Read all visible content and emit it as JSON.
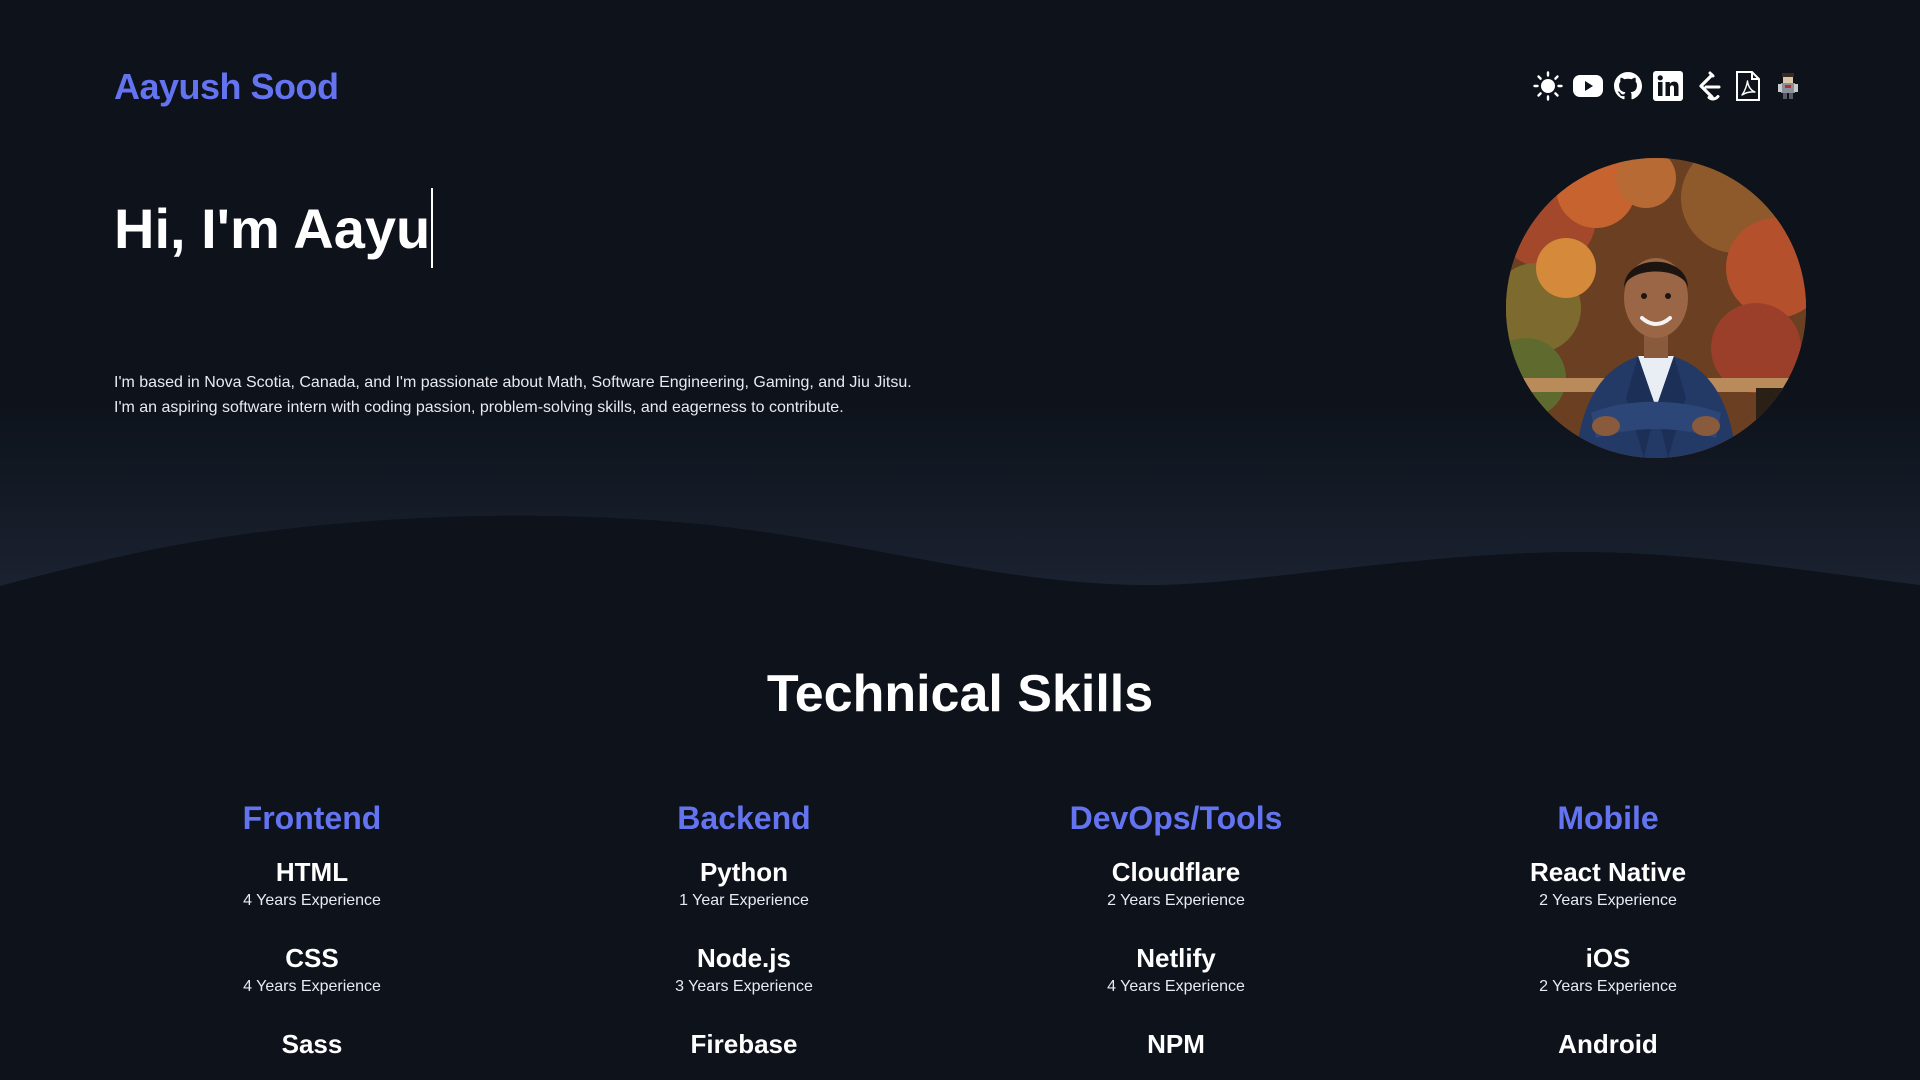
{
  "header": {
    "brand": "Aayush Sood",
    "icons": [
      {
        "name": "sun-icon",
        "label": "Toggle theme"
      },
      {
        "name": "youtube-icon",
        "label": "YouTube"
      },
      {
        "name": "github-icon",
        "label": "GitHub"
      },
      {
        "name": "linkedin-icon",
        "label": "LinkedIn"
      },
      {
        "name": "leetcode-icon",
        "label": "LeetCode"
      },
      {
        "name": "pdf-icon",
        "label": "Resume"
      },
      {
        "name": "character-icon",
        "label": "Game"
      }
    ]
  },
  "hero": {
    "greeting": "Hi, I'm Aayu",
    "line1": "I'm based in Nova Scotia, Canada, and I'm passionate about Math, Software Engineering, Gaming, and Jiu Jitsu.",
    "line2": "I'm an aspiring software intern with coding passion, problem-solving skills, and eagerness to contribute."
  },
  "skills": {
    "title": "Technical Skills",
    "categories": [
      {
        "title": "Frontend",
        "items": [
          {
            "name": "HTML",
            "experience": "4 Years Experience"
          },
          {
            "name": "CSS",
            "experience": "4 Years Experience"
          },
          {
            "name": "Sass",
            "experience": ""
          }
        ]
      },
      {
        "title": "Backend",
        "items": [
          {
            "name": "Python",
            "experience": "1 Year Experience"
          },
          {
            "name": "Node.js",
            "experience": "3 Years Experience"
          },
          {
            "name": "Firebase",
            "experience": ""
          }
        ]
      },
      {
        "title": "DevOps/Tools",
        "items": [
          {
            "name": "Cloudflare",
            "experience": "2 Years Experience"
          },
          {
            "name": "Netlify",
            "experience": "4 Years Experience"
          },
          {
            "name": "NPM",
            "experience": ""
          }
        ]
      },
      {
        "title": "Mobile",
        "items": [
          {
            "name": "React Native",
            "experience": "2 Years Experience"
          },
          {
            "name": "iOS",
            "experience": "2 Years Experience"
          },
          {
            "name": "Android",
            "experience": ""
          }
        ]
      }
    ]
  },
  "colors": {
    "background": "#0d121b",
    "wave": "#181e2a",
    "accent": "#6474f0"
  }
}
